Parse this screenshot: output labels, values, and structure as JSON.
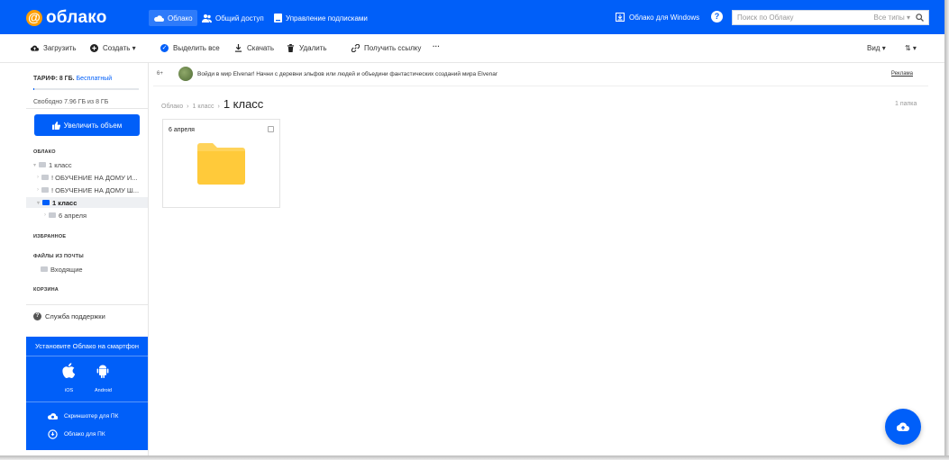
{
  "header": {
    "logo_symbol": "@",
    "logo_text": "облако",
    "nav": [
      {
        "label": "Облако",
        "icon": "cloud-icon",
        "active": true
      },
      {
        "label": "Общий доступ",
        "icon": "users-icon",
        "active": false
      },
      {
        "label": "Управление подписками",
        "icon": "subscription-icon",
        "active": false
      }
    ],
    "windows_link": "Облако для Windows",
    "help_symbol": "?",
    "search_placeholder": "Поиск по Облаку",
    "search_types": "Все типы ▾",
    "accent_color": "#005ff9"
  },
  "toolbar": {
    "upload": "Загрузить",
    "create": "Создать ▾",
    "select_all": "Выделить все",
    "download": "Скачать",
    "delete": "Удалить",
    "get_link": "Получить ссылку",
    "more": "···",
    "view": "Вид ▾",
    "sort": "⇅ ▾"
  },
  "sidebar": {
    "tariff_label": "ТАРИФ: 8 ГБ.",
    "tariff_plan": "Бесплатный",
    "quota_used_fraction": 0.005,
    "free_space": "Свободно 7.96 ГБ из 8 ГБ",
    "increase_button": "Увеличить объем",
    "section_cloud": "ОБЛАКО",
    "tree": [
      {
        "label": "1 класс",
        "selected": false
      },
      {
        "label": "! ОБУЧЕНИЕ НА ДОМУ И...",
        "selected": false
      },
      {
        "label": "! ОБУЧЕНИЕ НА ДОМУ Ш...",
        "selected": false
      },
      {
        "label": "1 класс",
        "selected": true
      },
      {
        "label": "6 апреля",
        "selected": false
      }
    ],
    "section_favorites": "ИЗБРАННОЕ",
    "section_mail_files": "ФАЙЛЫ ИЗ ПОЧТЫ",
    "inbox": "Входящие",
    "section_trash": "КОРЗИНА",
    "support": "Служба поддержки"
  },
  "promo": {
    "title": "Установите Облако на смартфон",
    "ios": "iOS",
    "android": "Android",
    "screenshoter": "Скриншотер для ПК",
    "cloud_pc": "Облако для ПК"
  },
  "ad": {
    "number": "6+",
    "text": "Войди в мир Elvenar!   Начни с деревни эльфов или людей и объедини фантастических созданий мира Elvenar",
    "link": "Реклама"
  },
  "breadcrumb": {
    "root": "Облако",
    "sep1": "›",
    "parent": "1 класс",
    "sep2": "›",
    "current": "1 класс"
  },
  "folder_count": "1 папка",
  "items": [
    {
      "name": "6 апреля",
      "type": "folder",
      "folder_color": "#ffd35a"
    }
  ]
}
